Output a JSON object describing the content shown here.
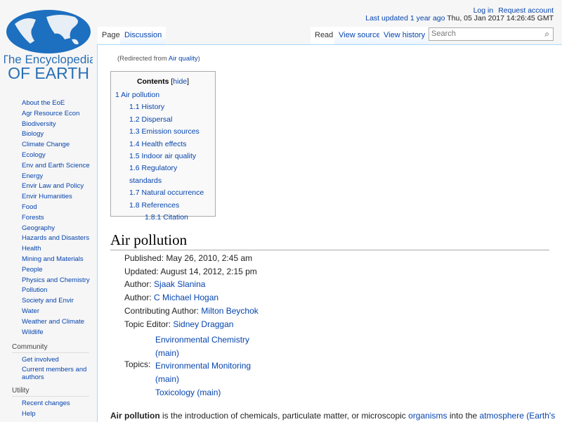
{
  "logo": {
    "line1": "The Encyclopedia",
    "line2": "OF EARTH"
  },
  "sidebar": {
    "items": [
      "About the EoE",
      "Agr Resource Econ",
      "Biodiversity",
      "Biology",
      "Climate Change",
      "Ecology",
      "Env and Earth Science",
      "Energy",
      "Envir Law and Policy",
      "Envir Humanities",
      "Food",
      "Forests",
      "Geography",
      "Hazards and Disasters",
      "Health",
      "Mining and Materials",
      "People",
      "Physics and Chemistry",
      "Pollution",
      "Society and Envir",
      "Water",
      "Weather and Climate",
      "Wildlife"
    ],
    "community": {
      "title": "Community",
      "items": [
        "Get involved",
        "Current members and authors"
      ]
    },
    "utility": {
      "title": "Utility",
      "items": [
        "Recent changes",
        "Help"
      ]
    }
  },
  "personal": {
    "login": "Log in",
    "request": "Request account"
  },
  "updated": {
    "link": "Last updated 1 year ago",
    "date": " Thu, 05 Jan 2017 14:26:45 GMT"
  },
  "tabs": {
    "page": "Page",
    "discussion": "Discussion",
    "read": "Read",
    "view_source": "View source",
    "view_history": "View history"
  },
  "search": {
    "placeholder": "Search"
  },
  "redirect": {
    "prefix": "(Redirected from ",
    "link": "Air quality",
    "suffix": ")"
  },
  "toc": {
    "title": "Contents",
    "hide": "hide",
    "items": [
      {
        "label": "1 Air pollution",
        "level": 1
      },
      {
        "label": "1.1 History",
        "level": 2
      },
      {
        "label": "1.2 Dispersal",
        "level": 2
      },
      {
        "label": "1.3 Emission sources",
        "level": 2
      },
      {
        "label": "1.4 Health effects",
        "level": 2
      },
      {
        "label": "1.5 Indoor air quality",
        "level": 2
      },
      {
        "label": "1.6 Regulatory standards",
        "level": 2
      },
      {
        "label": "1.7 Natural occurrence",
        "level": 2
      },
      {
        "label": "1.8 References",
        "level": 2
      },
      {
        "label": "1.8.1 Citation",
        "level": 3
      }
    ]
  },
  "article": {
    "title": "Air pollution",
    "meta": [
      {
        "label": "Published: May 26, 2010, 2:45 am",
        "link": ""
      },
      {
        "label": "Updated: August 14, 2012, 2:15 pm",
        "link": ""
      },
      {
        "label": "Author: ",
        "link": "Sjaak Slanina"
      },
      {
        "label": "Author: ",
        "link": "C Michael Hogan"
      },
      {
        "label": "Contributing Author: ",
        "link": "Milton Beychok"
      },
      {
        "label": "Topic Editor: ",
        "link": "Sidney Draggan"
      }
    ],
    "topics_label": "Topics:",
    "topics": [
      "Environmental Chemistry (main)",
      "Environmental Monitoring (main)",
      "Toxicology (main)"
    ],
    "para": {
      "bold": "Air pollution",
      "t1": " is the introduction of chemicals, particulate matter, or microscopic ",
      "l1": "organisms",
      "t2": " into the ",
      "l2": "atmosphere (Earth's"
    }
  }
}
